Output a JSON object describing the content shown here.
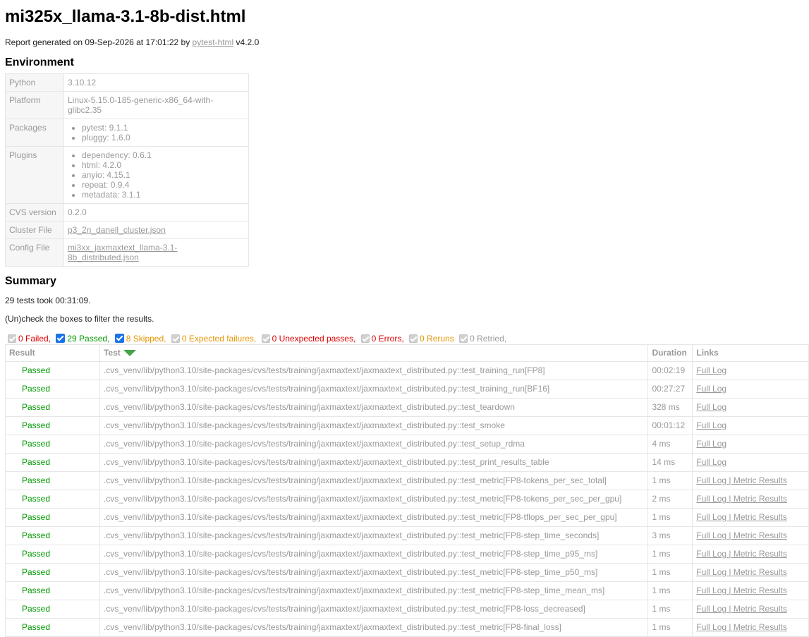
{
  "title": "mi325x_llama-3.1-8b-dist.html",
  "generated": {
    "prefix": "Report generated on 09-Sep-2026 at 17:01:22 by ",
    "link": "pytest-html",
    "suffix": " v4.2.0"
  },
  "environment": {
    "heading": "Environment",
    "python": {
      "label": "Python",
      "value": "3.10.12"
    },
    "platform": {
      "label": "Platform",
      "value": "Linux-5.15.0-185-generic-x86_64-with-glibc2.35"
    },
    "packages": {
      "label": "Packages",
      "items": [
        "pytest: 9.1.1",
        "pluggy: 1.6.0"
      ]
    },
    "plugins": {
      "label": "Plugins",
      "items": [
        "dependency: 0.6.1",
        "html: 4.2.0",
        "anyio: 4.15.1",
        "repeat: 0.9.4",
        "metadata: 3.1.1"
      ]
    },
    "cvs_version": {
      "label": "CVS version",
      "value": "0.2.0"
    },
    "cluster_file": {
      "label": "Cluster File",
      "value": "p3_2n_danell_cluster.json"
    },
    "config_file": {
      "label": "Config File",
      "value": "mi3xx_jaxmaxtext_llama-3.1-8b_distributed.json"
    }
  },
  "summary": {
    "heading": "Summary",
    "duration_text": "29 tests took 00:31:09.",
    "filter_hint": "(Un)check the boxes to filter the results."
  },
  "filters": {
    "failed": "0 Failed,",
    "passed": "29 Passed,",
    "skipped": "8 Skipped,",
    "xfailed": "0 Expected failures,",
    "xpassed": "0 Unexpected passes,",
    "errors": "0 Errors,",
    "reruns": "0 Reruns",
    "retried": "0 Retried,"
  },
  "results_table": {
    "headers": {
      "result": "Result",
      "test": "Test",
      "duration": "Duration",
      "links": "Links"
    },
    "full_log_label": "Full Log",
    "metric_label": " | Metric Results",
    "rows": [
      {
        "result": "Passed",
        "test": ".cvs_venv/lib/python3.10/site-packages/cvs/tests/training/jaxmaxtext/jaxmaxtext_distributed.py::test_training_run[FP8]",
        "duration": "00:02:19",
        "metric": false
      },
      {
        "result": "Passed",
        "test": ".cvs_venv/lib/python3.10/site-packages/cvs/tests/training/jaxmaxtext/jaxmaxtext_distributed.py::test_training_run[BF16]",
        "duration": "00:27:27",
        "metric": false
      },
      {
        "result": "Passed",
        "test": ".cvs_venv/lib/python3.10/site-packages/cvs/tests/training/jaxmaxtext/jaxmaxtext_distributed.py::test_teardown",
        "duration": "328 ms",
        "metric": false
      },
      {
        "result": "Passed",
        "test": ".cvs_venv/lib/python3.10/site-packages/cvs/tests/training/jaxmaxtext/jaxmaxtext_distributed.py::test_smoke",
        "duration": "00:01:12",
        "metric": false
      },
      {
        "result": "Passed",
        "test": ".cvs_venv/lib/python3.10/site-packages/cvs/tests/training/jaxmaxtext/jaxmaxtext_distributed.py::test_setup_rdma",
        "duration": "4 ms",
        "metric": false
      },
      {
        "result": "Passed",
        "test": ".cvs_venv/lib/python3.10/site-packages/cvs/tests/training/jaxmaxtext/jaxmaxtext_distributed.py::test_print_results_table",
        "duration": "14 ms",
        "metric": false
      },
      {
        "result": "Passed",
        "test": ".cvs_venv/lib/python3.10/site-packages/cvs/tests/training/jaxmaxtext/jaxmaxtext_distributed.py::test_metric[FP8-tokens_per_sec_total]",
        "duration": "1 ms",
        "metric": true
      },
      {
        "result": "Passed",
        "test": ".cvs_venv/lib/python3.10/site-packages/cvs/tests/training/jaxmaxtext/jaxmaxtext_distributed.py::test_metric[FP8-tokens_per_sec_per_gpu]",
        "duration": "2 ms",
        "metric": true
      },
      {
        "result": "Passed",
        "test": ".cvs_venv/lib/python3.10/site-packages/cvs/tests/training/jaxmaxtext/jaxmaxtext_distributed.py::test_metric[FP8-tflops_per_sec_per_gpu]",
        "duration": "1 ms",
        "metric": true
      },
      {
        "result": "Passed",
        "test": ".cvs_venv/lib/python3.10/site-packages/cvs/tests/training/jaxmaxtext/jaxmaxtext_distributed.py::test_metric[FP8-step_time_seconds]",
        "duration": "3 ms",
        "metric": true
      },
      {
        "result": "Passed",
        "test": ".cvs_venv/lib/python3.10/site-packages/cvs/tests/training/jaxmaxtext/jaxmaxtext_distributed.py::test_metric[FP8-step_time_p95_ms]",
        "duration": "1 ms",
        "metric": true
      },
      {
        "result": "Passed",
        "test": ".cvs_venv/lib/python3.10/site-packages/cvs/tests/training/jaxmaxtext/jaxmaxtext_distributed.py::test_metric[FP8-step_time_p50_ms]",
        "duration": "1 ms",
        "metric": true
      },
      {
        "result": "Passed",
        "test": ".cvs_venv/lib/python3.10/site-packages/cvs/tests/training/jaxmaxtext/jaxmaxtext_distributed.py::test_metric[FP8-step_time_mean_ms]",
        "duration": "1 ms",
        "metric": true
      },
      {
        "result": "Passed",
        "test": ".cvs_venv/lib/python3.10/site-packages/cvs/tests/training/jaxmaxtext/jaxmaxtext_distributed.py::test_metric[FP8-loss_decreased]",
        "duration": "1 ms",
        "metric": true
      },
      {
        "result": "Passed",
        "test": ".cvs_venv/lib/python3.10/site-packages/cvs/tests/training/jaxmaxtext/jaxmaxtext_distributed.py::test_metric[FP8-final_loss]",
        "duration": "1 ms",
        "metric": true
      }
    ]
  }
}
